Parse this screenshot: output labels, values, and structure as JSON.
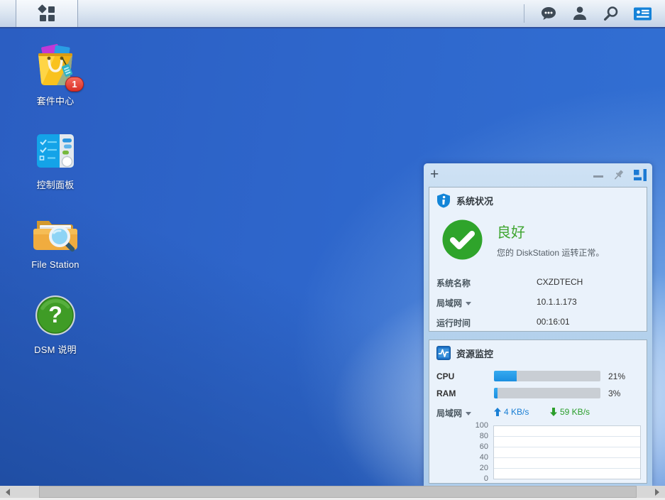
{
  "topbar": {
    "icons": [
      "main-menu",
      "notifications-chat",
      "user-options",
      "search",
      "pilot-view"
    ]
  },
  "desktop_icons": [
    {
      "label": "套件中心",
      "badge": "1"
    },
    {
      "label": "控制面板"
    },
    {
      "label": "File Station"
    },
    {
      "label": "DSM 说明"
    }
  ],
  "widget_panel": {
    "system_health": {
      "title": "系统状况",
      "status": "良好",
      "description": "您的 DiskStation 运转正常。",
      "info_rows": [
        {
          "label": "系统名称",
          "value": "CXZDTECH"
        },
        {
          "label": "局域网",
          "value": "10.1.1.173",
          "dropdown": true
        },
        {
          "label": "运行时间",
          "value": "00:16:01"
        }
      ]
    },
    "resource_monitor": {
      "title": "资源监控",
      "rows": [
        {
          "label": "CPU",
          "percent": 21,
          "value": "21%"
        },
        {
          "label": "RAM",
          "percent": 3,
          "value": "3%"
        }
      ],
      "lan": {
        "label": "局域网",
        "upload": "4 KB/s",
        "download": "59 KB/s"
      }
    }
  },
  "chart_data": {
    "type": "line",
    "title": "",
    "xlabel": "",
    "ylabel": "",
    "ylim": [
      0,
      100
    ],
    "yticks": [
      "100",
      "80",
      "60",
      "40",
      "20",
      "0"
    ],
    "grid": true,
    "x": [],
    "series": []
  },
  "colors": {
    "accent_blue": "#1482d8",
    "status_green": "#2fa42b",
    "cpu_bar_fill": "#1b8fe0",
    "bar_track": "#c9ced4",
    "upload_blue": "#1a7fd4",
    "download_green": "#2b9e2b",
    "desktop_blue": "#2e65ca"
  }
}
